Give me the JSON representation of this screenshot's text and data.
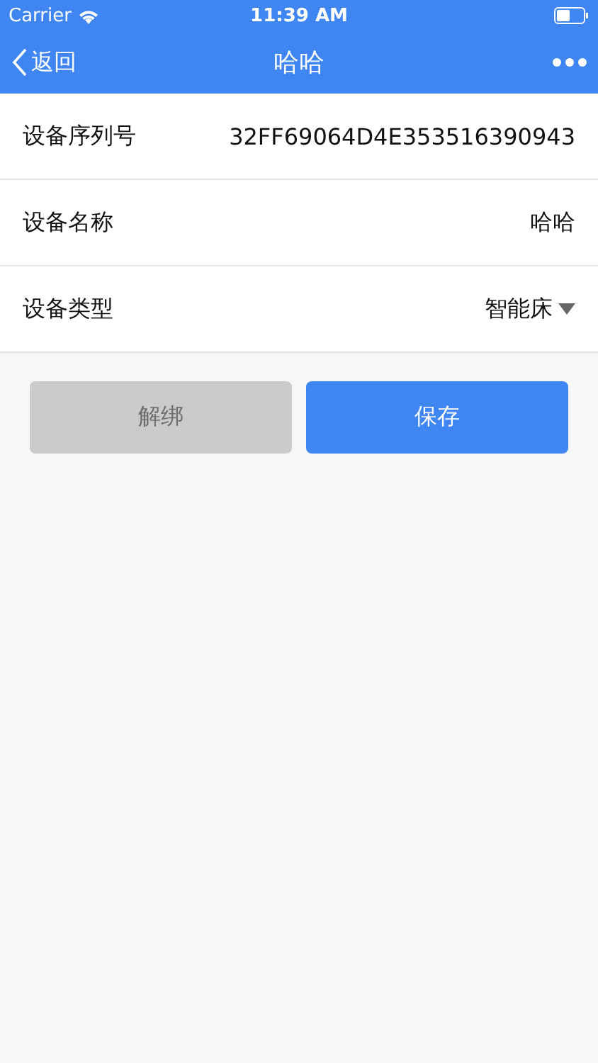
{
  "status_bar": {
    "carrier": "Carrier",
    "time": "11:39 AM"
  },
  "nav_bar": {
    "back": "返回",
    "title": "哈哈"
  },
  "fields": [
    {
      "label": "设备序列号",
      "value": "32FF69064D4E353516390943",
      "kind": "text"
    },
    {
      "label": "设备名称",
      "value": "哈哈",
      "kind": "text"
    },
    {
      "label": "设备类型",
      "value": "智能床",
      "kind": "dropdown"
    }
  ],
  "buttons": [
    {
      "label": "解绑",
      "disabled": true
    },
    {
      "label": "保存",
      "disabled": false
    }
  ]
}
